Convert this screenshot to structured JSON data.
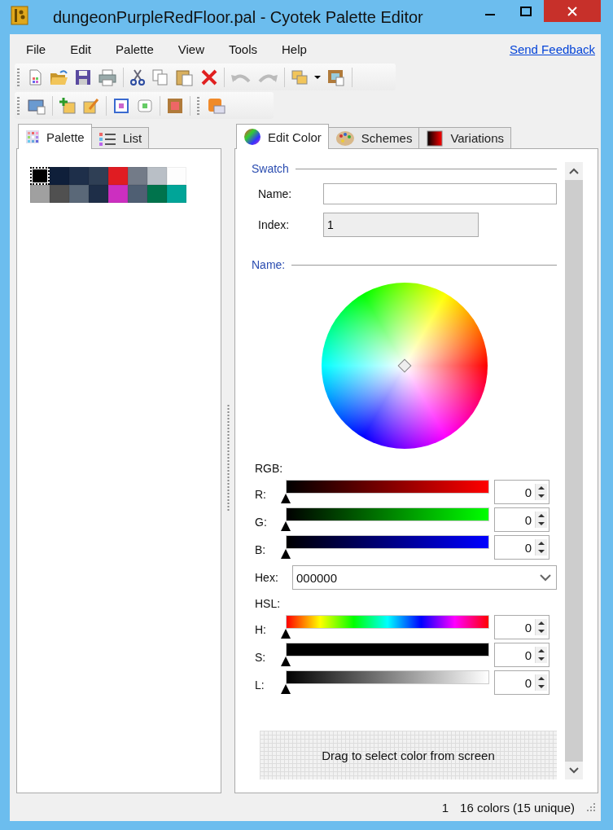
{
  "window": {
    "title": "dungeonPurpleRedFloor.pal - Cyotek Palette Editor"
  },
  "menu": [
    "File",
    "Edit",
    "Palette",
    "View",
    "Tools",
    "Help"
  ],
  "feedback_link": "Send Feedback",
  "left_tabs": [
    {
      "label": "Palette",
      "selected": true
    },
    {
      "label": "List",
      "selected": false
    }
  ],
  "swatches": [
    {
      "color": "#000000",
      "selected": true
    },
    {
      "color": "#0f1f3a",
      "selected": false
    },
    {
      "color": "#1e2f4a",
      "selected": false
    },
    {
      "color": "#2f3f55",
      "selected": false
    },
    {
      "color": "#e01c22",
      "selected": false
    },
    {
      "color": "#737b88",
      "selected": false
    },
    {
      "color": "#b9bfc6",
      "selected": false
    },
    {
      "color": "#fdfdfd",
      "selected": false
    },
    {
      "color": "#a0a0a0",
      "selected": false
    },
    {
      "color": "#505050",
      "selected": false
    },
    {
      "color": "#5a6878",
      "selected": false
    },
    {
      "color": "#1e2e48",
      "selected": false
    },
    {
      "color": "#cc2fc0",
      "selected": false
    },
    {
      "color": "#4f5f73",
      "selected": false
    },
    {
      "color": "#00734c",
      "selected": false
    },
    {
      "color": "#00a598",
      "selected": false
    }
  ],
  "right_tabs": [
    {
      "label": "Edit Color",
      "selected": true
    },
    {
      "label": "Schemes",
      "selected": false
    },
    {
      "label": "Variations",
      "selected": false
    }
  ],
  "swatch_section": {
    "title": "Swatch",
    "name_label": "Name:",
    "index_label": "Index:",
    "index_value": "1"
  },
  "name_section": {
    "title": "Name:"
  },
  "rgb": {
    "title": "RGB:",
    "channels": [
      {
        "label": "R:",
        "kind": "red",
        "level": 0,
        "value": "0"
      },
      {
        "label": "G:",
        "kind": "green",
        "level": 0,
        "value": "0"
      },
      {
        "label": "B:",
        "kind": "blue",
        "level": 0,
        "value": "0"
      }
    ]
  },
  "hex": {
    "label": "Hex:",
    "value": "000000"
  },
  "hsl": {
    "title": "HSL:",
    "channels": [
      {
        "label": "H:",
        "kind": "hue",
        "level": 0,
        "value": "0"
      },
      {
        "label": "S:",
        "kind": "saturation",
        "level": 0,
        "value": "0"
      },
      {
        "label": "L:",
        "kind": "lightness",
        "level": 0,
        "value": "0"
      }
    ]
  },
  "eyedropper": "Drag to select color from screen",
  "status_bar": {
    "index": "1",
    "count": "16 colors (15 unique)"
  }
}
